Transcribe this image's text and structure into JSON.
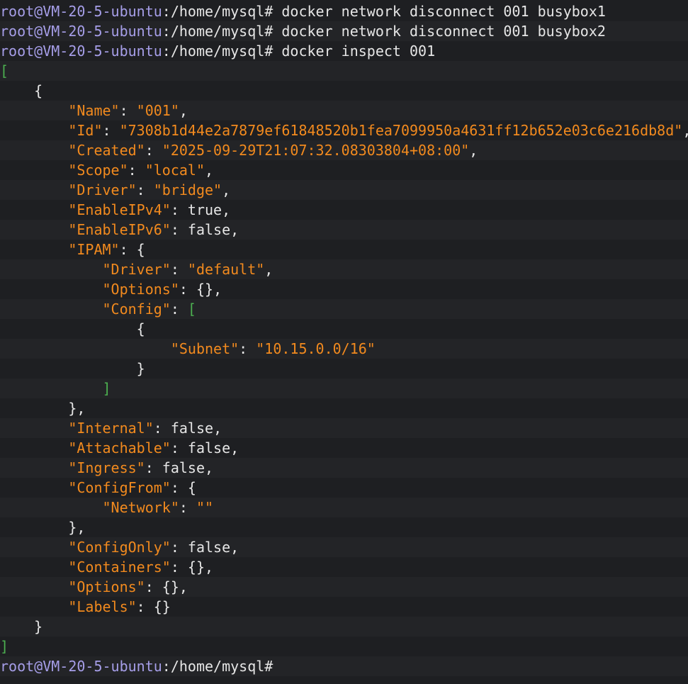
{
  "terminal": {
    "prompt_user": "root@VM-20-5-ubuntu",
    "prompt_path": ":/home/mysql#",
    "commands": [
      " docker network disconnect 001 busybox1",
      " docker network disconnect 001 busybox2",
      " docker inspect 001"
    ],
    "json": {
      "open_bracket": "[",
      "obj_open": "    {",
      "name_key": "\"Name\"",
      "name_val": "\"001\"",
      "id_key": "\"Id\"",
      "id_val": "\"7308b1d44e2a7879ef61848520b1fea7099950a4631ff12b652e03c6e216db8d\"",
      "created_key": "\"Created\"",
      "created_val": "\"2025-09-29T21:07:32.08303804+08:00\"",
      "scope_key": "\"Scope\"",
      "scope_val": "\"local\"",
      "driver_key": "\"Driver\"",
      "driver_val": "\"bridge\"",
      "ipv4_key": "\"EnableIPv4\"",
      "ipv4_val": "true",
      "ipv6_key": "\"EnableIPv6\"",
      "ipv6_val": "false",
      "ipam_key": "\"IPAM\"",
      "ipam_driver_key": "\"Driver\"",
      "ipam_driver_val": "\"default\"",
      "ipam_options_key": "\"Options\"",
      "ipam_options_val": "{}",
      "ipam_config_key": "\"Config\"",
      "subnet_key": "\"Subnet\"",
      "subnet_val": "\"10.15.0.0/16\"",
      "internal_key": "\"Internal\"",
      "internal_val": "false",
      "attachable_key": "\"Attachable\"",
      "attachable_val": "false",
      "ingress_key": "\"Ingress\"",
      "ingress_val": "false",
      "configfrom_key": "\"ConfigFrom\"",
      "network_key": "\"Network\"",
      "network_val": "\"\"",
      "configonly_key": "\"ConfigOnly\"",
      "configonly_val": "false",
      "containers_key": "\"Containers\"",
      "containers_val": "{}",
      "options_key": "\"Options\"",
      "options_val": "{}",
      "labels_key": "\"Labels\"",
      "labels_val": "{}",
      "obj_close": "    }",
      "close_bracket": "]"
    },
    "colors": {
      "background": "#1e1f22",
      "prompt_user": "#a69ee8",
      "key_string": "#f28a1e",
      "bracket": "#4caf50",
      "text": "#e6e6e6"
    }
  }
}
